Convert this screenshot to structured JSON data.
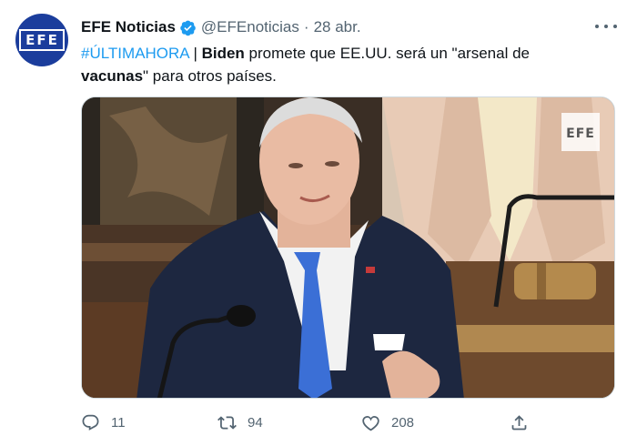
{
  "author": {
    "display_name": "EFE Noticias",
    "handle": "@EFEnoticias",
    "separator": "·",
    "date": "28 abr.",
    "avatar_text": "EFE",
    "verified": true,
    "avatar_color": "#1b3d9c"
  },
  "tweet": {
    "hashtag": "#ÚLTIMAHORA",
    "pipe": " | ",
    "word_biden": "Biden",
    "text_1": " promete que EE.UU. será un \"arsenal de ",
    "word_vacunas": "vacunas",
    "text_2": "\" para otros países."
  },
  "media": {
    "watermark": "EFE",
    "description_icon": "photo"
  },
  "actions": {
    "reply_count": "11",
    "retweet_count": "94",
    "like_count": "208"
  },
  "colors": {
    "accent": "#1d9bf0",
    "verified": "#1d9bf0",
    "secondary_text": "#536471"
  },
  "icons": {
    "reply": "reply-icon",
    "retweet": "retweet-icon",
    "like": "heart-icon",
    "share": "share-icon",
    "more": "more-icon",
    "verified": "verified-badge-icon"
  }
}
